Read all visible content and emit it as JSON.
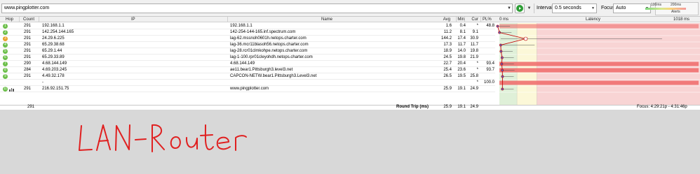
{
  "toolbar": {
    "target": "www.pingplotter.com",
    "interval_label": "Interval",
    "interval_value": "0.5 seconds",
    "focus_label": "Focus",
    "focus_value": "Auto",
    "alerts_label": "Alerts",
    "scale_100": "100ms",
    "scale_200": "200ms"
  },
  "headers": {
    "hop": "Hop",
    "count": "Count",
    "ip": "IP",
    "name": "Name",
    "avg": "Avg",
    "min": "Min",
    "cur": "Cur",
    "pl": "PL%",
    "lat_zero": "0 ms",
    "latency": "Latency",
    "lat_max": "1018 ms"
  },
  "hops": [
    {
      "hop": "1",
      "count": "291",
      "ip": "192.168.1.1",
      "name": "192.168.1.1",
      "avg": "1.6",
      "min": "0.4",
      "cur": "*",
      "pl": "48.8",
      "color": "#6cbf4a"
    },
    {
      "hop": "2",
      "count": "291",
      "ip": "142.254.144.165",
      "name": "142-254-144-165.inf.spectrum.com",
      "avg": "11.2",
      "min": "8.1",
      "cur": "9.1",
      "pl": "",
      "color": "#6cbf4a"
    },
    {
      "hop": "3",
      "count": "291",
      "ip": "24.29.6.225",
      "name": "lag-62.mssnoh0601h.netops.charter.com",
      "avg": "144.2",
      "min": "17.4",
      "cur": "30.9",
      "pl": "",
      "color": "#e8a12a"
    },
    {
      "hop": "4",
      "count": "291",
      "ip": "65.29.38.68",
      "name": "lag-36.mcr11blasoh56.netops.charter.com",
      "avg": "17.3",
      "min": "11.7",
      "cur": "11.7",
      "pl": "",
      "color": "#6cbf4a"
    },
    {
      "hop": "5",
      "count": "291",
      "ip": "65.29.1.44",
      "name": "lag-28.rcr01clmkohpe.netops.charter.com",
      "avg": "18.9",
      "min": "14.0",
      "cur": "19.8",
      "pl": "",
      "color": "#6cbf4a"
    },
    {
      "hop": "6",
      "count": "291",
      "ip": "65.29.33.89",
      "name": "lag-1-100.rpr01cleyohdh.netops.charter.com",
      "avg": "24.5",
      "min": "19.8",
      "cur": "21.9",
      "pl": "",
      "color": "#6cbf4a"
    },
    {
      "hop": "7",
      "count": "290",
      "ip": "4.68.144.149",
      "name": "4.68.144.149",
      "avg": "22.7",
      "min": "20.4",
      "cur": "*",
      "pl": "93.4",
      "color": "#6cbf4a"
    },
    {
      "hop": "8",
      "count": "284",
      "ip": "4.69.203.245",
      "name": "ae11.bear1.Pittsburgh3.level3.net",
      "avg": "25.4",
      "min": "23.6",
      "cur": "*",
      "pl": "93.7",
      "color": "#6cbf4a"
    },
    {
      "hop": "9",
      "count": "291",
      "ip": "4.49.32.178",
      "name": "CAPCON-NETW.bear1.Pittsburgh3.Level3.net",
      "avg": "26.5",
      "min": "19.5",
      "cur": "25.8",
      "pl": "",
      "color": "#6cbf4a"
    },
    {
      "hop": "",
      "count": "",
      "ip": "-",
      "name": "",
      "avg": "",
      "min": "",
      "cur": "*",
      "pl": "100.0",
      "color": ""
    },
    {
      "hop": "11",
      "count": "291",
      "ip": "216.92.151.75",
      "name": "www.pingplotter.com",
      "avg": "25.9",
      "min": "19.1",
      "cur": "24.9",
      "pl": "",
      "color": "#6cbf4a"
    }
  ],
  "summary": {
    "count": "291",
    "label": "Round Trip (ms)",
    "avg": "25.9",
    "min": "19.1",
    "cur": "24.9",
    "focus": "Focus: 4:29:21p - 4:31:46p"
  },
  "annotation": "LAN-Router",
  "colors": {
    "good": "#6cbf4a",
    "warn": "#e8a12a",
    "lat_green": "#dff0d8",
    "lat_yellow": "#fcf8d8",
    "lat_red": "#f8d4d4",
    "loss_red": "#f07070",
    "annotation_red": "#e02020"
  }
}
